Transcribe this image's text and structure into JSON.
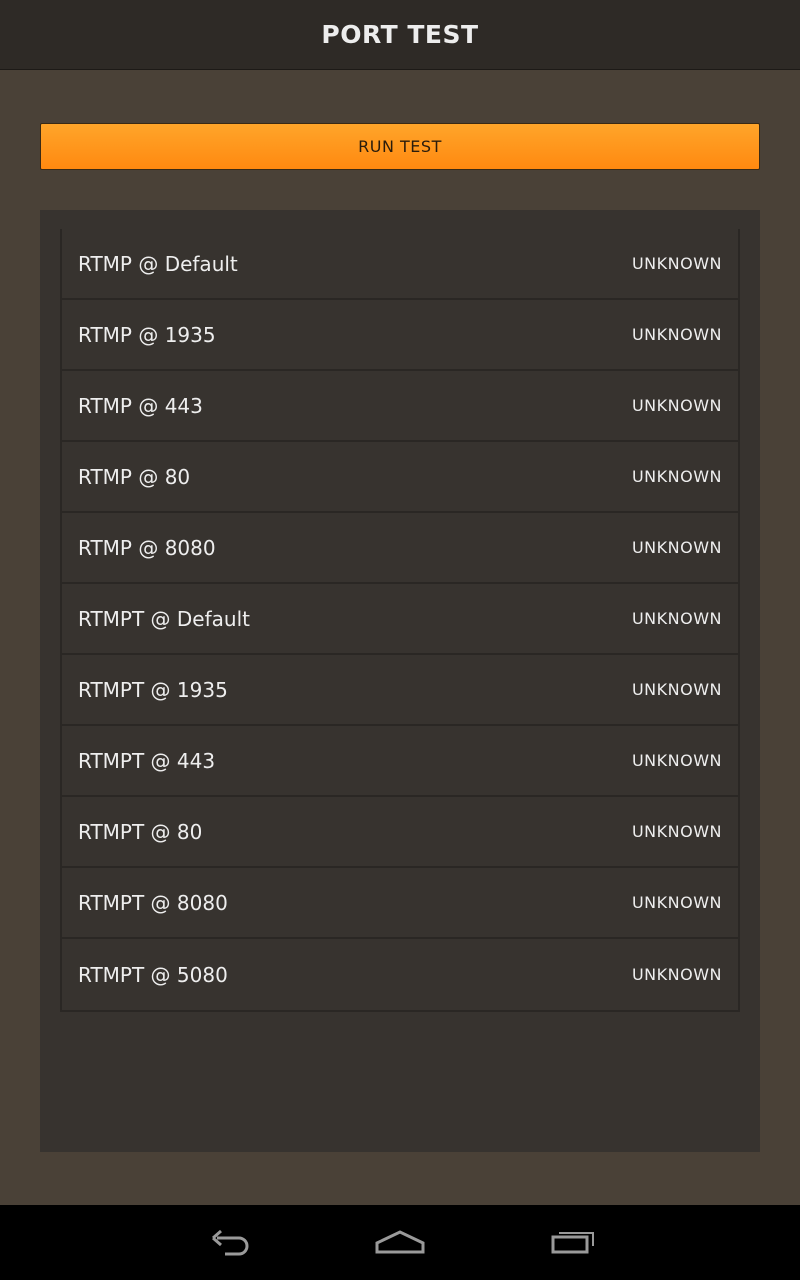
{
  "header": {
    "title": "PORT TEST"
  },
  "actions": {
    "run_label": "RUN TEST"
  },
  "ports": [
    {
      "label": "RTMP @ Default",
      "status": "UNKNOWN"
    },
    {
      "label": "RTMP @ 1935",
      "status": "UNKNOWN"
    },
    {
      "label": "RTMP @ 443",
      "status": "UNKNOWN"
    },
    {
      "label": "RTMP @ 80",
      "status": "UNKNOWN"
    },
    {
      "label": "RTMP @ 8080",
      "status": "UNKNOWN"
    },
    {
      "label": "RTMPT @ Default",
      "status": "UNKNOWN"
    },
    {
      "label": "RTMPT @ 1935",
      "status": "UNKNOWN"
    },
    {
      "label": "RTMPT @ 443",
      "status": "UNKNOWN"
    },
    {
      "label": "RTMPT @ 80",
      "status": "UNKNOWN"
    },
    {
      "label": "RTMPT @ 8080",
      "status": "UNKNOWN"
    },
    {
      "label": "RTMPT @ 5080",
      "status": "UNKNOWN"
    }
  ],
  "navigation": {
    "icons": [
      "back-icon",
      "home-icon",
      "recent-apps-icon"
    ]
  },
  "colors": {
    "accent": "#ff9a1f",
    "background": "#4a4137",
    "panel": "#37332f",
    "titlebar": "#2e2a26"
  }
}
